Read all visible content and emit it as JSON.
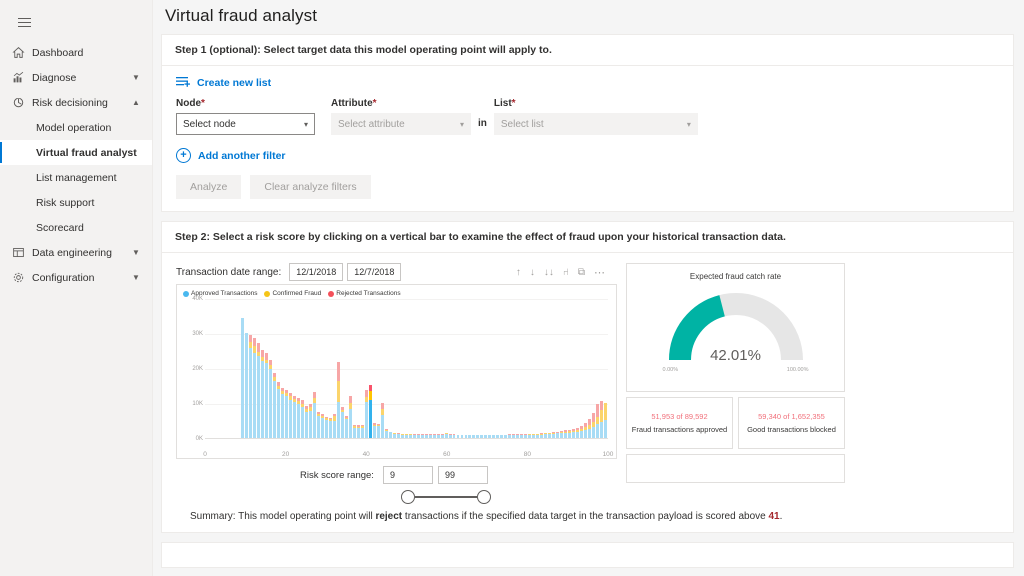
{
  "sidebar": {
    "menu_icon": "hamburger-icon",
    "items": [
      {
        "label": "Dashboard",
        "icon": "home-icon",
        "level": 0,
        "chevron": "",
        "active": false
      },
      {
        "label": "Diagnose",
        "icon": "chart-icon",
        "level": 0,
        "chevron": "⌄",
        "active": false
      },
      {
        "label": "Risk decisioning",
        "icon": "shield-icon",
        "level": 0,
        "chevron": "⌃",
        "active": false
      },
      {
        "label": "Model operation",
        "icon": "",
        "level": 1,
        "chevron": "",
        "active": false
      },
      {
        "label": "Virtual fraud analyst",
        "icon": "",
        "level": 1,
        "chevron": "",
        "active": true
      },
      {
        "label": "List management",
        "icon": "",
        "level": 1,
        "chevron": "",
        "active": false
      },
      {
        "label": "Risk support",
        "icon": "",
        "level": 1,
        "chevron": "",
        "active": false
      },
      {
        "label": "Scorecard",
        "icon": "",
        "level": 1,
        "chevron": "",
        "active": false
      },
      {
        "label": "Data engineering",
        "icon": "table-icon",
        "level": 0,
        "chevron": "⌄",
        "active": false
      },
      {
        "label": "Configuration",
        "icon": "gear-icon",
        "level": 0,
        "chevron": "⌄",
        "active": false
      }
    ]
  },
  "page": {
    "title": "Virtual fraud analyst"
  },
  "step1": {
    "heading": "Step 1 (optional): Select target data this model operating point will apply to.",
    "create_new_list": "Create new list",
    "fields": {
      "node": {
        "label": "Node",
        "required": "*",
        "value": "Select node",
        "disabled": false
      },
      "attribute": {
        "label": "Attribute",
        "required": "*",
        "value": "Select attribute",
        "disabled": true
      },
      "in_word": "in",
      "list": {
        "label": "List",
        "required": "*",
        "value": "Select list",
        "disabled": true
      }
    },
    "add_another_filter": "Add another filter",
    "analyze_button": "Analyze",
    "clear_button": "Clear analyze filters"
  },
  "step2": {
    "heading": "Step 2: Select a risk score by clicking on a vertical bar to examine the effect of fraud upon your historical transaction data.",
    "date_range_label": "Transaction date range:",
    "date_from": "12/1/2018",
    "date_to": "12/7/2018",
    "tools": [
      {
        "name": "sort-ascending-icon",
        "glyph": "↑"
      },
      {
        "name": "sort-descending-icon",
        "glyph": "↓"
      },
      {
        "name": "sort-double-icon",
        "glyph": "↓↓"
      },
      {
        "name": "drill-hierarchy-icon",
        "glyph": "⑁"
      },
      {
        "name": "focus-mode-icon",
        "glyph": "⧉"
      },
      {
        "name": "more-options-icon",
        "glyph": "⋯"
      }
    ],
    "risk_score_range_label": "Risk score range:",
    "risk_score_min": "9",
    "risk_score_max": "99",
    "summary_prefix": "Summary: This model operating point will ",
    "summary_action": "reject",
    "summary_mid": " transactions if the specified data target in the transaction payload is scored above ",
    "summary_score": "41",
    "summary_suffix": "."
  },
  "gauge": {
    "title": "Expected fraud catch rate",
    "value_label": "42.01%",
    "value": 42.01,
    "min_label": "0.00%",
    "max_label": "100.00%",
    "fill_color": "#00b3a4",
    "track_color": "#e6e6e6"
  },
  "stats": [
    {
      "number": "51,953 of 89,592",
      "label": "Fraud transactions approved"
    },
    {
      "number": "59,340 of 1,652,355",
      "label": "Good transactions blocked"
    }
  ],
  "chart_data": {
    "type": "bar",
    "stacked": true,
    "title": "",
    "xlabel": "",
    "ylabel": "",
    "xlim": [
      0,
      100
    ],
    "ylim": [
      0,
      40000
    ],
    "ytick_labels": [
      "0K",
      "10K",
      "20K",
      "30K",
      "40K"
    ],
    "ytick_values": [
      0,
      10000,
      20000,
      30000,
      40000
    ],
    "xtick_labels": [
      "0",
      "20",
      "40",
      "60",
      "80",
      "100"
    ],
    "xtick_values": [
      0,
      20,
      40,
      60,
      80,
      100
    ],
    "grid": true,
    "legend_position": "top-left",
    "selected_x": 41,
    "colors": {
      "approved": "#a8dcf5",
      "fraud": "#fbd46b",
      "rejected": "#f7a6a6",
      "approved_selected": "#32b2ed",
      "fraud_selected": "#ffc400",
      "rejected_selected": "#f9546b"
    },
    "legend": [
      {
        "name": "Approved Transactions",
        "color": "#49b8ef"
      },
      {
        "name": "Confirmed Fraud",
        "color": "#f5c518"
      },
      {
        "name": "Rejected Transactions",
        "color": "#f4505a"
      }
    ],
    "x": [
      0,
      1,
      2,
      3,
      4,
      5,
      6,
      7,
      8,
      9,
      10,
      11,
      12,
      13,
      14,
      15,
      16,
      17,
      18,
      19,
      20,
      21,
      22,
      23,
      24,
      25,
      26,
      27,
      28,
      29,
      30,
      31,
      32,
      33,
      34,
      35,
      36,
      37,
      38,
      39,
      40,
      41,
      42,
      43,
      44,
      45,
      46,
      47,
      48,
      49,
      50,
      51,
      52,
      53,
      54,
      55,
      56,
      57,
      58,
      59,
      60,
      61,
      62,
      63,
      64,
      65,
      66,
      67,
      68,
      69,
      70,
      71,
      72,
      73,
      74,
      75,
      76,
      77,
      78,
      79,
      80,
      81,
      82,
      83,
      84,
      85,
      86,
      87,
      88,
      89,
      90,
      91,
      92,
      93,
      94,
      95,
      96,
      97,
      98,
      99,
      100
    ],
    "series": [
      {
        "name": "Approved Transactions",
        "values": [
          0,
          0,
          0,
          0,
          0,
          0,
          0,
          0,
          0,
          34400,
          30100,
          25800,
          24200,
          23400,
          22000,
          21400,
          19600,
          16400,
          14000,
          12600,
          12100,
          11000,
          10300,
          9700,
          8900,
          7500,
          7800,
          9900,
          6200,
          5700,
          5200,
          4800,
          5000,
          10200,
          7400,
          5400,
          8400,
          3000,
          2900,
          3000,
          10300,
          10900,
          3400,
          3300,
          6600,
          2100,
          1600,
          1200,
          1100,
          1000,
          1000,
          1000,
          900,
          900,
          900,
          900,
          900,
          900,
          900,
          900,
          1100,
          900,
          900,
          800,
          800,
          800,
          800,
          800,
          800,
          800,
          800,
          800,
          800,
          800,
          800,
          800,
          900,
          900,
          900,
          900,
          900,
          1000,
          1000,
          1000,
          1000,
          1100,
          1100,
          1200,
          1300,
          1400,
          1500,
          1500,
          1600,
          1800,
          2000,
          2300,
          2700,
          3200,
          3900,
          4500,
          5200,
          5400
        ]
      },
      {
        "name": "Confirmed Fraud",
        "values": [
          0,
          0,
          0,
          0,
          0,
          0,
          0,
          0,
          0,
          0,
          0,
          1500,
          2100,
          1300,
          1200,
          1000,
          1200,
          1000,
          900,
          900,
          800,
          900,
          900,
          800,
          700,
          800,
          1000,
          1400,
          600,
          600,
          500,
          500,
          1200,
          6000,
          500,
          400,
          1700,
          300,
          300,
          300,
          1500,
          2600,
          400,
          400,
          1800,
          200,
          150,
          100,
          100,
          100,
          100,
          100,
          100,
          100,
          100,
          100,
          100,
          100,
          100,
          100,
          200,
          100,
          100,
          100,
          100,
          100,
          100,
          100,
          100,
          100,
          100,
          100,
          100,
          100,
          100,
          100,
          100,
          100,
          100,
          100,
          100,
          150,
          150,
          150,
          150,
          200,
          200,
          200,
          250,
          300,
          350,
          400,
          450,
          500,
          600,
          800,
          1100,
          1500,
          2200,
          3400,
          4900,
          5400
        ]
      },
      {
        "name": "Rejected Transactions",
        "values": [
          0,
          0,
          0,
          0,
          0,
          0,
          0,
          0,
          0,
          0,
          0,
          2100,
          2300,
          2400,
          2000,
          2000,
          1400,
          1100,
          1000,
          900,
          800,
          900,
          800,
          900,
          1200,
          800,
          1000,
          1800,
          600,
          500,
          400,
          400,
          700,
          5600,
          1000,
          600,
          1900,
          500,
          400,
          400,
          2000,
          1700,
          400,
          400,
          1500,
          200,
          100,
          100,
          100,
          100,
          100,
          100,
          100,
          100,
          100,
          100,
          100,
          100,
          100,
          100,
          150,
          100,
          100,
          100,
          100,
          100,
          100,
          100,
          100,
          100,
          100,
          100,
          100,
          100,
          100,
          100,
          100,
          100,
          100,
          100,
          100,
          100,
          100,
          100,
          150,
          150,
          200,
          200,
          250,
          300,
          350,
          400,
          500,
          600,
          800,
          1200,
          1700,
          2400,
          3600,
          2700
        ]
      }
    ]
  }
}
